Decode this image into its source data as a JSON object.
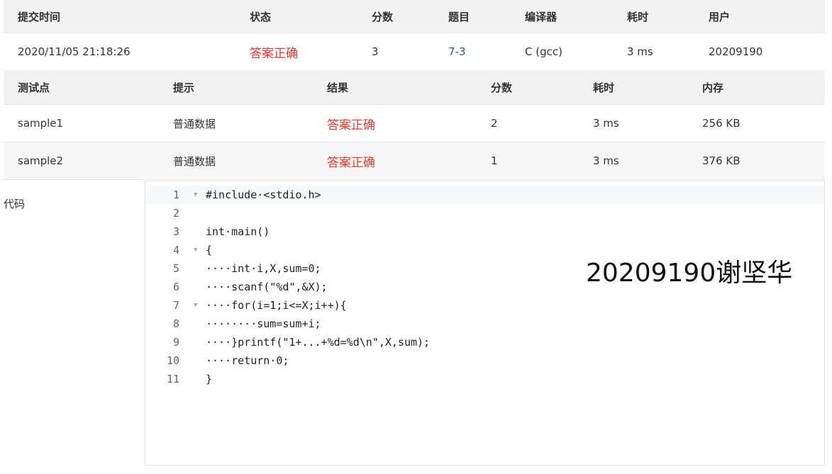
{
  "submission": {
    "headers": [
      "提交时间",
      "状态",
      "分数",
      "题目",
      "编译器",
      "耗时",
      "用户"
    ],
    "row": {
      "time": "2020/11/05 21:18:26",
      "status": "答案正确",
      "score": "3",
      "problem": "7-3",
      "compiler": "C (gcc)",
      "elapsed": "3 ms",
      "user": "20209190"
    }
  },
  "testcases": {
    "headers": [
      "测试点",
      "提示",
      "结果",
      "分数",
      "耗时",
      "内存"
    ],
    "rows": [
      {
        "name": "sample1",
        "hint": "普通数据",
        "result": "答案正确",
        "score": "2",
        "time": "3 ms",
        "memory": "256 KB"
      },
      {
        "name": "sample2",
        "hint": "普通数据",
        "result": "答案正确",
        "score": "1",
        "time": "3 ms",
        "memory": "376 KB"
      }
    ]
  },
  "code_label": "代码",
  "code": {
    "line_numbers": [
      "1",
      "2",
      "3",
      "4",
      "5",
      "6",
      "7",
      "8",
      "9",
      "10",
      "11"
    ],
    "lines": [
      "#include·<stdio.h>",
      "",
      "int·main()",
      "{",
      "····int·i,X,sum=0;",
      "····scanf(\"%d\",&X);",
      "····for(i=1;i<=X;i++){",
      "········sum=sum+i;",
      "····}printf(\"1+...+%d=%d\\n\",X,sum);",
      "····return·0;",
      "}"
    ]
  },
  "watermark": "20209190谢坚华",
  "colors": {
    "status_ok": "#e8392d",
    "link": "#1a5eaa",
    "header_bg": "#f2f2f2"
  }
}
